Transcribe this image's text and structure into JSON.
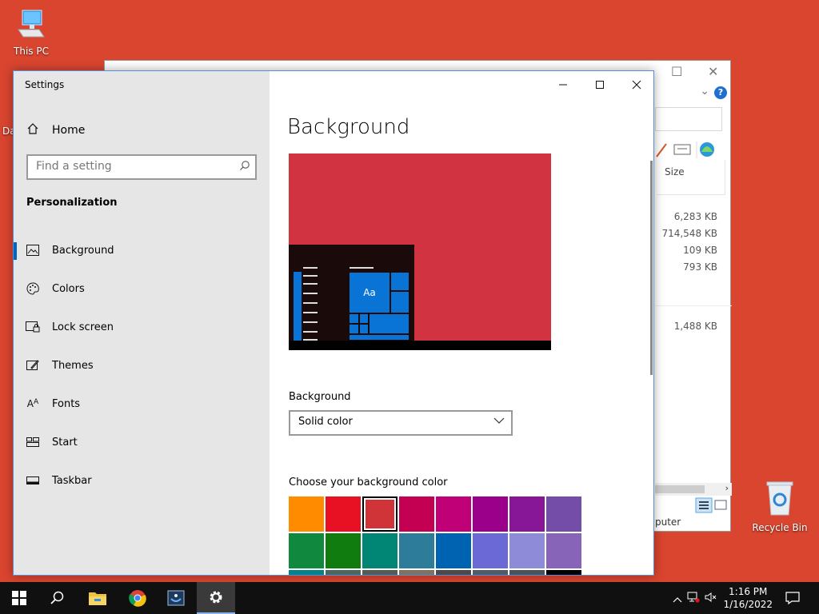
{
  "desktop": {
    "this_pc_label": "This PC",
    "partial_label": "Da",
    "recycle_bin_label": "Recycle Bin"
  },
  "explorer": {
    "column_size": "Size",
    "sizes": [
      "6,283 KB",
      "714,548 KB",
      "109 KB",
      "793 KB",
      "1,488 KB"
    ],
    "status_text": "puter"
  },
  "settings": {
    "window_title": "Settings",
    "home_label": "Home",
    "search_placeholder": "Find a setting",
    "section_title": "Personalization",
    "nav_items": [
      {
        "label": "Background",
        "icon": "image-icon"
      },
      {
        "label": "Colors",
        "icon": "palette-icon"
      },
      {
        "label": "Lock screen",
        "icon": "lock-screen-icon"
      },
      {
        "label": "Themes",
        "icon": "themes-icon"
      },
      {
        "label": "Fonts",
        "icon": "fonts-icon"
      },
      {
        "label": "Start",
        "icon": "start-icon"
      },
      {
        "label": "Taskbar",
        "icon": "taskbar-icon"
      }
    ],
    "selected_nav": "Background",
    "page_title": "Background",
    "preview_tile_text": "Aa",
    "background_label": "Background",
    "background_value": "Solid color",
    "choose_color_label": "Choose your background color",
    "swatches": [
      "#ff8c00",
      "#e81123",
      "#d13438",
      "#c30052",
      "#bf0077",
      "#9a0089",
      "#881798",
      "#744da9",
      "#10893e",
      "#107c10",
      "#018574",
      "#2d7d9a",
      "#0063b1",
      "#6b69d6",
      "#8e8cd8",
      "#8764b8",
      "#038387",
      "#486860",
      "#525e54",
      "#7e735f",
      "#4c4a48",
      "#515c6b",
      "#4a5459",
      "#000000"
    ],
    "selected_swatch": "#d13438"
  },
  "taskbar": {
    "time": "1:16 PM",
    "date": "1/16/2022"
  },
  "colors": {
    "desktop": "#d9452f",
    "accent": "#0067c0",
    "preview_bg": "#d13440"
  }
}
